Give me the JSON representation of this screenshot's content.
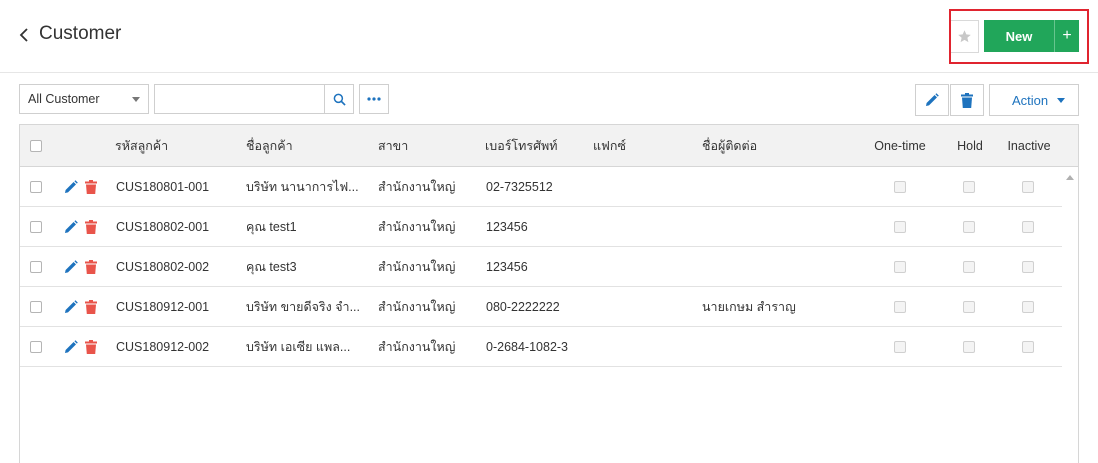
{
  "header": {
    "title": "Customer",
    "new_label": "New",
    "plus_label": "+"
  },
  "toolbar": {
    "filter_value": "All Customer",
    "search_placeholder": "",
    "more_label": "•••",
    "action_label": "Action"
  },
  "table": {
    "columns": {
      "code": "รหัสลูกค้า",
      "name": "ชื่อลูกค้า",
      "branch": "สาขา",
      "phone": "เบอร์โทรศัพท์",
      "fax": "แฟกซ์",
      "contact": "ชื่อผู้ติดต่อ",
      "onetime": "One-time",
      "hold": "Hold",
      "inactive": "Inactive"
    },
    "rows": [
      {
        "code": "CUS180801-001",
        "name": "บริษัท นานาการไฟ...",
        "branch": "สำนักงานใหญ่",
        "phone": "02-7325512",
        "fax": "",
        "contact": ""
      },
      {
        "code": "CUS180802-001",
        "name": "คุณ test1",
        "branch": "สำนักงานใหญ่",
        "phone": "123456",
        "fax": "",
        "contact": ""
      },
      {
        "code": "CUS180802-002",
        "name": "คุณ test3",
        "branch": "สำนักงานใหญ่",
        "phone": "123456",
        "fax": "",
        "contact": ""
      },
      {
        "code": "CUS180912-001",
        "name": "บริษัท ขายดีจริง จำ...",
        "branch": "สำนักงานใหญ่",
        "phone": "080-2222222",
        "fax": "",
        "contact": "นายเกษม สำราญ"
      },
      {
        "code": "CUS180912-002",
        "name": "บริษัท เอเซีย แพล...",
        "branch": "สำนักงานใหญ่",
        "phone": "0-2684-1082-3",
        "fax": "",
        "contact": ""
      }
    ]
  },
  "colors": {
    "primary_green": "#21a65a",
    "link_blue": "#1e73be",
    "delete_red": "#e9544b",
    "highlight_red": "#e0242f"
  },
  "icons": {
    "back": "chevron-left-icon",
    "star": "star-icon",
    "search": "search-icon",
    "more": "more-horizontal-icon",
    "edit": "pencil-icon",
    "delete": "trash-icon"
  }
}
